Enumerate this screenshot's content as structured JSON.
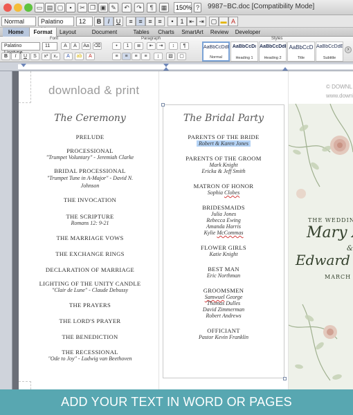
{
  "window": {
    "title": "9987~BC.doc [Compatibility Mode]",
    "zoom": "150%"
  },
  "format_bar": {
    "style": "Normal",
    "font": "Palatino Lino",
    "size": "12"
  },
  "ribbon": {
    "tabs": [
      "Home",
      "Format",
      "Layout",
      "Document Elements",
      "Tables",
      "Charts",
      "SmartArt",
      "Review",
      "Developer"
    ],
    "active_tab": "Format",
    "group_labels": {
      "font": "Font",
      "paragraph": "Paragraph",
      "styles": "Styles"
    },
    "font": "Palatino Linotype",
    "size": "11",
    "styles": [
      {
        "sample": "AaBbCcDdEe",
        "name": "Normal"
      },
      {
        "sample": "AaBbCcDı",
        "name": "Heading 1"
      },
      {
        "sample": "AaBbCcDdE",
        "name": "Heading 2"
      },
      {
        "sample": "AaBbCcD",
        "name": "Title"
      },
      {
        "sample": "AaBbCcDdE",
        "name": "Subtitle"
      }
    ]
  },
  "document": {
    "logo": "download & print",
    "copyright": [
      "© DOWNL",
      "www.downlo"
    ],
    "ceremony": {
      "title": "The Ceremony",
      "items": [
        {
          "heading": "PRELUDE",
          "sub": ""
        },
        {
          "heading": "PROCESSIONAL",
          "sub": "\"Trumpet Voluntary\" - Jeremiah Clarke"
        },
        {
          "heading": "BRIDAL PROCESSIONAL",
          "sub": "\"Trumpet Tune in A-Major\"  - David N. Johnson"
        },
        {
          "heading": "THE INVOCATION",
          "sub": ""
        },
        {
          "heading": "THE SCRIPTURE",
          "sub": "Romans 12: 9-21"
        },
        {
          "heading": "THE MARRIAGE VOWS",
          "sub": ""
        },
        {
          "heading": "THE EXCHANGE RINGS",
          "sub": ""
        },
        {
          "heading": "DECLARATION OF MARRIAGE",
          "sub": ""
        },
        {
          "heading": "LIGHTING OF THE UNITY CANDLE",
          "sub": "\"Clair de Lune\" - Claude Debussy"
        },
        {
          "heading": "THE PRAYERS",
          "sub": ""
        },
        {
          "heading": "THE LORD'S PRAYER",
          "sub": ""
        },
        {
          "heading": "THE BENEDICTION",
          "sub": ""
        },
        {
          "heading": "THE RECESSIONAL",
          "sub": "\"Ode to Joy\" - Ludwig van Beethoven"
        }
      ]
    },
    "bridal_party": {
      "title": "The Bridal Party",
      "parents_bride": {
        "heading": "PARENTS OF THE BRIDE",
        "names": [
          "Robert & Karen Jones"
        ]
      },
      "parents_groom": {
        "heading": "PARENTS OF THE GROOM",
        "names": [
          "Mark Knight",
          "Ericka & Jeff Smith"
        ]
      },
      "matron": {
        "heading": "MATRON OF HONOR",
        "first": "Sophia ",
        "last": "Clobes"
      },
      "bridesmaids": {
        "heading": "BRIDESMAIDS",
        "names": [
          "Julia Jones",
          "Rebecca Ewing",
          "Amanda Harris"
        ],
        "last_first": "Kylie ",
        "last_last": "McCommas"
      },
      "flower_girls": {
        "heading": "FLOWER GIRLS",
        "names": [
          "Katie Knight"
        ]
      },
      "best_man": {
        "heading": "BEST MAN",
        "names": [
          "Eric Northman"
        ]
      },
      "groomsmen": {
        "heading": "GROOMSMEN",
        "first_a": "Samwuel",
        "first_b": " George",
        "names": [
          "Thomas Dulles",
          "David Zimmerman",
          "Robert Andrews"
        ]
      },
      "officiant": {
        "heading": "OFFICIANT",
        "names": [
          "Pastor Kevin Franklin"
        ]
      }
    },
    "cover": {
      "line1": "THE WEDDING",
      "name1": "Mary A",
      "amp": "&",
      "name2": "Edward M",
      "date": "MARCH"
    }
  },
  "banner": "ADD YOUR TEXT IN WORD OR PAGES",
  "colors": {
    "banner": "#58a7b1",
    "highlight": "#b5d3f5",
    "floral_bg": "#eef1e9"
  }
}
